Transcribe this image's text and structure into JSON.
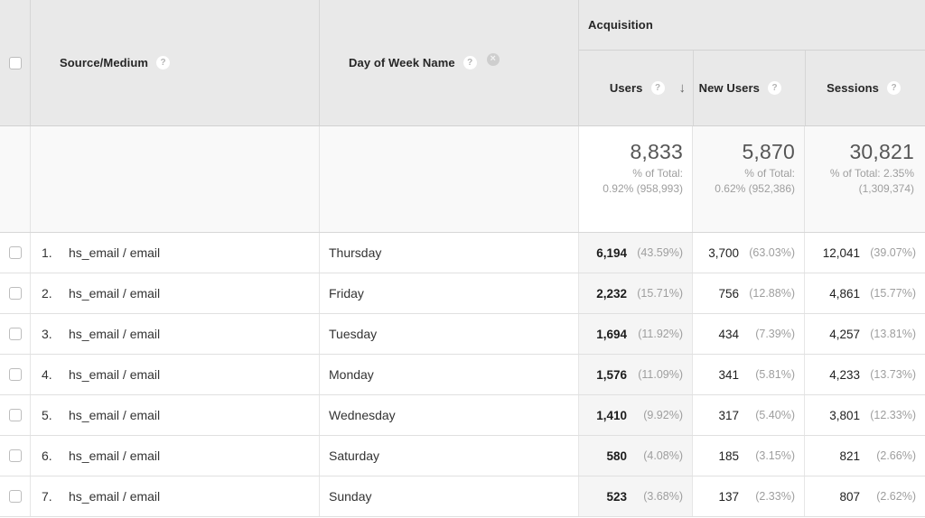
{
  "colors": {
    "header_bg": "#e9e9e9",
    "summary_bg": "#f9f9f9",
    "sorted_column_bg": "#f5f5f5",
    "row_bg": "#ffffff",
    "border": "#e0e0e0",
    "muted_text": "#9e9e9e"
  },
  "header": {
    "group_label": "Acquisition",
    "source_medium_label": "Source/Medium",
    "day_of_week_label": "Day of Week Name",
    "users_label": "Users",
    "new_users_label": "New Users",
    "sessions_label": "Sessions",
    "help_icon_glyph": "?",
    "remove_icon_glyph": "×",
    "sort_desc_icon_glyph": "↓"
  },
  "summary": {
    "users_value": "8,833",
    "users_pct": "% of Total:\n0.92% (958,993)",
    "new_users_value": "5,870",
    "new_users_pct": "% of Total:\n0.62% (952,386)",
    "sessions_value": "30,821",
    "sessions_pct": "% of Total: 2.35%\n(1,309,374)"
  },
  "rows": [
    {
      "index": "1.",
      "source_medium": "hs_email / email",
      "day": "Thursday",
      "users": "6,194",
      "users_pct": "(43.59%)",
      "new_users": "3,700",
      "new_users_pct": "(63.03%)",
      "sessions": "12,041",
      "sessions_pct": "(39.07%)"
    },
    {
      "index": "2.",
      "source_medium": "hs_email / email",
      "day": "Friday",
      "users": "2,232",
      "users_pct": "(15.71%)",
      "new_users": "756",
      "new_users_pct": "(12.88%)",
      "sessions": "4,861",
      "sessions_pct": "(15.77%)"
    },
    {
      "index": "3.",
      "source_medium": "hs_email / email",
      "day": "Tuesday",
      "users": "1,694",
      "users_pct": "(11.92%)",
      "new_users": "434",
      "new_users_pct": "(7.39%)",
      "sessions": "4,257",
      "sessions_pct": "(13.81%)"
    },
    {
      "index": "4.",
      "source_medium": "hs_email / email",
      "day": "Monday",
      "users": "1,576",
      "users_pct": "(11.09%)",
      "new_users": "341",
      "new_users_pct": "(5.81%)",
      "sessions": "4,233",
      "sessions_pct": "(13.73%)"
    },
    {
      "index": "5.",
      "source_medium": "hs_email / email",
      "day": "Wednesday",
      "users": "1,410",
      "users_pct": "(9.92%)",
      "new_users": "317",
      "new_users_pct": "(5.40%)",
      "sessions": "3,801",
      "sessions_pct": "(12.33%)"
    },
    {
      "index": "6.",
      "source_medium": "hs_email / email",
      "day": "Saturday",
      "users": "580",
      "users_pct": "(4.08%)",
      "new_users": "185",
      "new_users_pct": "(3.15%)",
      "sessions": "821",
      "sessions_pct": "(2.66%)"
    },
    {
      "index": "7.",
      "source_medium": "hs_email / email",
      "day": "Sunday",
      "users": "523",
      "users_pct": "(3.68%)",
      "new_users": "137",
      "new_users_pct": "(2.33%)",
      "sessions": "807",
      "sessions_pct": "(2.62%)"
    }
  ]
}
